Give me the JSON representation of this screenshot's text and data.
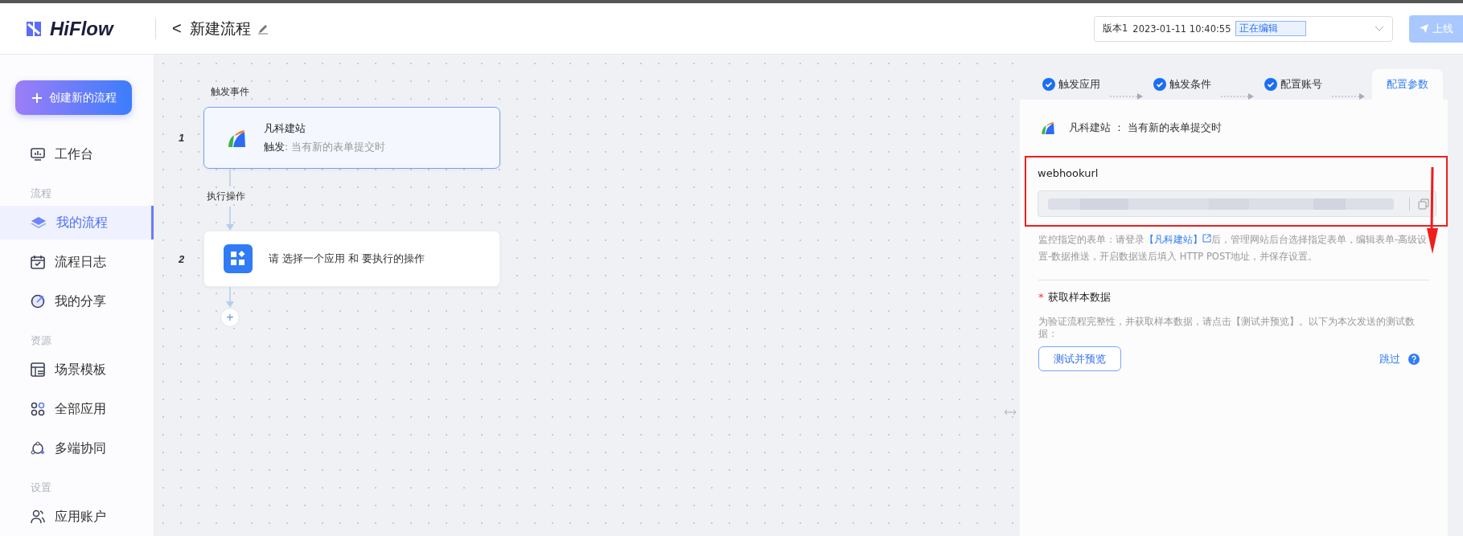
{
  "header": {
    "logo": "HiFlow",
    "back": "<",
    "title": "新建流程",
    "version": {
      "label": "版本1",
      "time": "2023-01-11 10:40:55",
      "status": "正在编辑"
    },
    "publish": "上线"
  },
  "sidebar": {
    "create": "创建新的流程",
    "items": [
      {
        "kind": "item",
        "label": "工作台",
        "selected": false
      },
      {
        "kind": "heading",
        "label": "流程"
      },
      {
        "kind": "item",
        "label": "我的流程",
        "selected": true
      },
      {
        "kind": "item",
        "label": "流程日志",
        "selected": false
      },
      {
        "kind": "item",
        "label": "我的分享",
        "selected": false
      },
      {
        "kind": "heading",
        "label": "资源"
      },
      {
        "kind": "item",
        "label": "场景模板",
        "selected": false
      },
      {
        "kind": "item",
        "label": "全部应用",
        "selected": false
      },
      {
        "kind": "item",
        "label": "多端协同",
        "selected": false
      },
      {
        "kind": "heading",
        "label": "设置"
      },
      {
        "kind": "item",
        "label": "应用账户",
        "selected": false
      }
    ]
  },
  "canvas": {
    "trigger_label": "触发事件",
    "action_label": "执行操作",
    "nodes": [
      {
        "number": "1",
        "kind": "app",
        "title": "凡科建站",
        "prefix": "触发",
        "detail": ": 当有新的表单提交时",
        "selected": true
      },
      {
        "number": "2",
        "kind": "empty",
        "text": "请 选择一个应用 和 要执行的操作",
        "selected": false
      }
    ],
    "add": "+"
  },
  "panel": {
    "steps": [
      {
        "label": "触发应用",
        "done": true,
        "selected": false
      },
      {
        "label": "触发条件",
        "done": true,
        "selected": false
      },
      {
        "label": "配置账号",
        "done": true,
        "selected": false
      },
      {
        "label": "配置参数",
        "done": false,
        "selected": true
      }
    ],
    "app_title": "凡科建站 ： 当有新的表单提交时",
    "field_label": "webhookurl",
    "help_before": "监控指定的表单：请登录",
    "help_link": "【凡科建站】",
    "help_after": "后，管理网站后台选择指定表单，编辑表单-高级设置-数据推送，开启数据送后填入 HTTP POST地址，并保存设置。",
    "required_mark": "*",
    "sample_heading": "获取样本数据",
    "sample_desc": "为验证流程完整性，并获取样本数据，请点击【测试并预览】。以下为本次发送的测试数据：",
    "test_button": "测试并预览",
    "skip": "跳过"
  }
}
